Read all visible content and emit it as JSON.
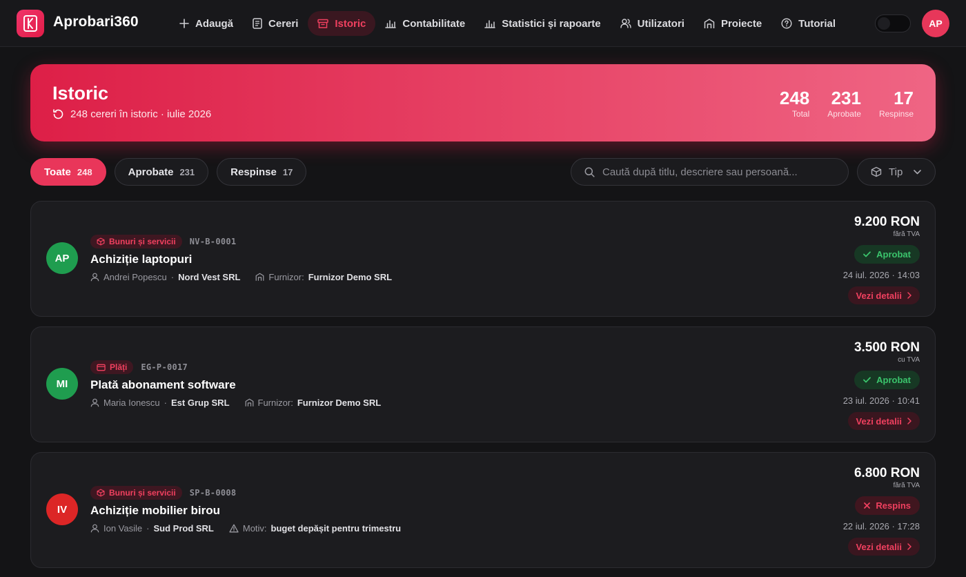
{
  "app": {
    "brand": "Aprobari360",
    "user_initials": "AP"
  },
  "nav": [
    {
      "label": "Adaugă",
      "icon": "plus-icon"
    },
    {
      "label": "Cereri",
      "icon": "document-icon"
    },
    {
      "label": "Istoric",
      "icon": "archive-icon",
      "active": true
    },
    {
      "label": "Contabilitate",
      "icon": "bar-chart-icon"
    },
    {
      "label": "Statistici și rapoarte",
      "icon": "bar-chart-icon"
    },
    {
      "label": "Utilizatori",
      "icon": "users-icon"
    },
    {
      "label": "Proiecte",
      "icon": "building-icon"
    },
    {
      "label": "Tutorial",
      "icon": "help-icon"
    }
  ],
  "hero": {
    "title": "Istoric",
    "subtitle": "248 cereri în istoric · iulie 2026",
    "stats": [
      {
        "value": "248",
        "label": "Total"
      },
      {
        "value": "231",
        "label": "Aprobate"
      },
      {
        "value": "17",
        "label": "Respinse"
      }
    ]
  },
  "filters": [
    {
      "label": "Toate",
      "count": "248",
      "active": true
    },
    {
      "label": "Aprobate",
      "count": "231"
    },
    {
      "label": "Respinse",
      "count": "17"
    }
  ],
  "search": {
    "placeholder": "Caută după titlu, descriere sau persoană...",
    "value": ""
  },
  "type_filter": {
    "label": "Tip"
  },
  "requests": [
    {
      "initials": "AP",
      "avatar_color": "#1f9d4f",
      "category": "Bunuri și servicii",
      "category_icon": "box-icon",
      "code": "NV-B-0001",
      "title": "Achiziție laptopuri",
      "person": "Andrei Popescu",
      "company": "Nord Vest SRL",
      "extra_icon": "building-icon",
      "extra_label": "Furnizor:",
      "extra_value": "Furnizor Demo SRL",
      "amount": "9.200 RON",
      "vat": "fără TVA",
      "status": "Aprobat",
      "status_type": "approved",
      "date": "24 iul. 2026 · 14:03",
      "details_label": "Vezi detalii"
    },
    {
      "initials": "MI",
      "avatar_color": "#1f9d4f",
      "category": "Plăți",
      "category_icon": "card-icon",
      "code": "EG-P-0017",
      "title": "Plată abonament software",
      "person": "Maria Ionescu",
      "company": "Est Grup SRL",
      "extra_icon": "building-icon",
      "extra_label": "Furnizor:",
      "extra_value": "Furnizor Demo SRL",
      "amount": "3.500 RON",
      "vat": "cu TVA",
      "status": "Aprobat",
      "status_type": "approved",
      "date": "23 iul. 2026 · 10:41",
      "details_label": "Vezi detalii"
    },
    {
      "initials": "IV",
      "avatar_color": "#dc2626",
      "category": "Bunuri și servicii",
      "category_icon": "box-icon",
      "code": "SP-B-0008",
      "title": "Achiziție mobilier birou",
      "person": "Ion Vasile",
      "company": "Sud Prod SRL",
      "extra_icon": "warning-icon",
      "extra_label": "Motiv:",
      "extra_value": "buget depășit pentru trimestru",
      "amount": "6.800 RON",
      "vat": "fără TVA",
      "status": "Respins",
      "status_type": "rejected",
      "date": "22 iul. 2026 · 17:28",
      "details_label": "Vezi detalii"
    }
  ]
}
